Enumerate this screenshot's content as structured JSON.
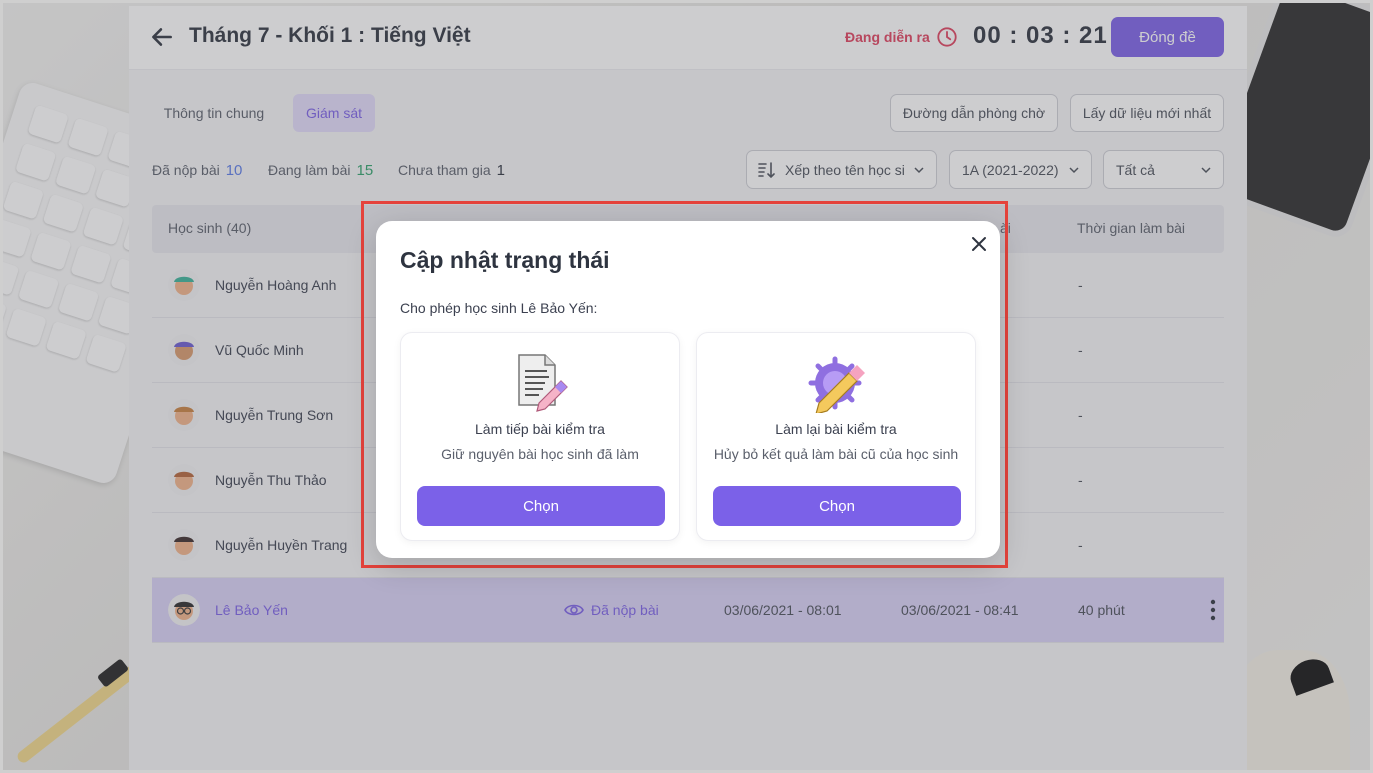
{
  "header": {
    "title": "Tháng 7 - Khối 1 : Tiếng Việt",
    "status": "Đang diễn ra",
    "timer": "00 : 03 : 21",
    "close_exam_label": "Đóng đề"
  },
  "tabs": [
    {
      "label": "Thông tin chung",
      "active": false
    },
    {
      "label": "Giám sát",
      "active": true
    }
  ],
  "toolbar": {
    "waiting_link_label": "Đường dẫn phòng chờ",
    "refresh_label": "Lấy dữ liệu mới nhất",
    "sort_label": "Xếp theo tên học si",
    "class_label": "1A (2021-2022)",
    "filter_label": "Tất cả"
  },
  "stats": {
    "submitted_label": "Đã nộp bài",
    "submitted_count": "10",
    "doing_label": "Đang làm bài",
    "doing_count": "15",
    "absent_label": "Chưa tham gia",
    "absent_count": "1"
  },
  "table": {
    "headers": [
      "Học sinh (40)",
      "ài",
      "Thời gian làm bài"
    ],
    "rows": [
      {
        "name": "Nguyễn Hoàng Anh",
        "duration": "-"
      },
      {
        "name": "Vũ Quốc Minh",
        "duration": "-"
      },
      {
        "name": "Nguyễn Trung Sơn",
        "duration": "-"
      },
      {
        "name": "Nguyễn Thu Thảo",
        "duration": "-"
      },
      {
        "name": "Nguyễn Huyền Trang",
        "duration": "-"
      },
      {
        "name": "Lê Bảo Yến",
        "status": "Đã nộp bài",
        "start": "03/06/2021 - 08:01",
        "end": "03/06/2021 - 08:41",
        "duration": "40 phút"
      }
    ]
  },
  "modal": {
    "title": "Cập nhật trạng thái",
    "description": "Cho phép học sinh Lê Bảo Yến:",
    "options": [
      {
        "title": "Làm tiếp bài kiểm tra",
        "subtitle": "Giữ nguyên bài học sinh đã làm",
        "button": "Chọn"
      },
      {
        "title": "Làm lại bài kiểm tra",
        "subtitle": "Hủy bỏ kết quả làm bài cũ của học sinh",
        "button": "Chọn"
      }
    ]
  },
  "colors": {
    "accent": "#7b61e8",
    "status_live": "#e0405e",
    "submitted": "#5b7be8",
    "doing": "#2fa36b",
    "highlight_box": "#e5433c"
  }
}
